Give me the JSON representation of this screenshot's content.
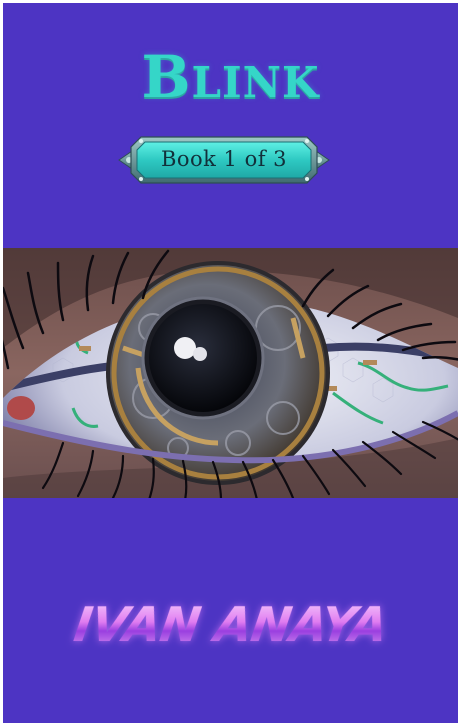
{
  "cover": {
    "title": "Blink",
    "series_badge": "Book 1 of 3",
    "author": "IVAN ANAYA",
    "artwork_subject": "mechanical-eye-illustration"
  },
  "colors": {
    "background": "#4d34c3",
    "title": "#35d6c8",
    "badge_fill": "#2ec9c2",
    "badge_frame": "#5c8a8c",
    "author_gradient_top": "#f8d8ff",
    "author_gradient_mid": "#9a3fe0"
  }
}
